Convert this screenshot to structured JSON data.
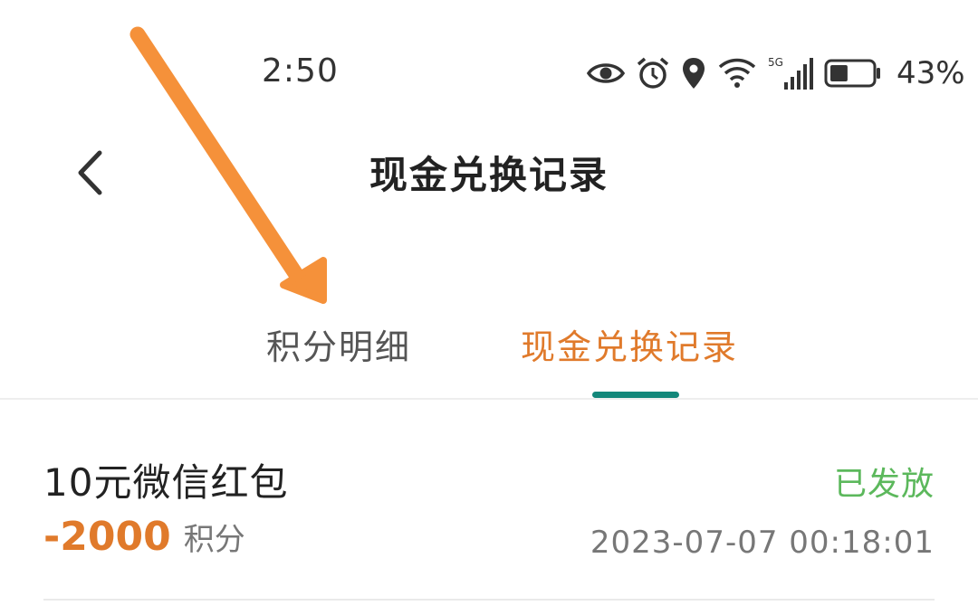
{
  "status_bar": {
    "time": "2:50",
    "network_label": "5G",
    "battery_percent": "43%",
    "battery_level": 0.43,
    "icons": [
      "eye-icon",
      "alarm-icon",
      "location-icon",
      "wifi-icon",
      "signal-icon",
      "battery-icon"
    ]
  },
  "header": {
    "title": "现金兑换记录",
    "back_icon": "chevron-left-icon"
  },
  "tabs": [
    {
      "label": "积分明细",
      "active": false
    },
    {
      "label": "现金兑换记录",
      "active": true
    }
  ],
  "records": [
    {
      "title": "10元微信红包",
      "status": "已发放",
      "points": "-2000",
      "points_unit": "积分",
      "time": "2023-07-07 00:18:01"
    }
  ],
  "colors": {
    "accent_orange": "#e07a2b",
    "indicator_teal": "#13877a",
    "status_green": "#5cb85c",
    "annotation_arrow": "#f5913a"
  }
}
